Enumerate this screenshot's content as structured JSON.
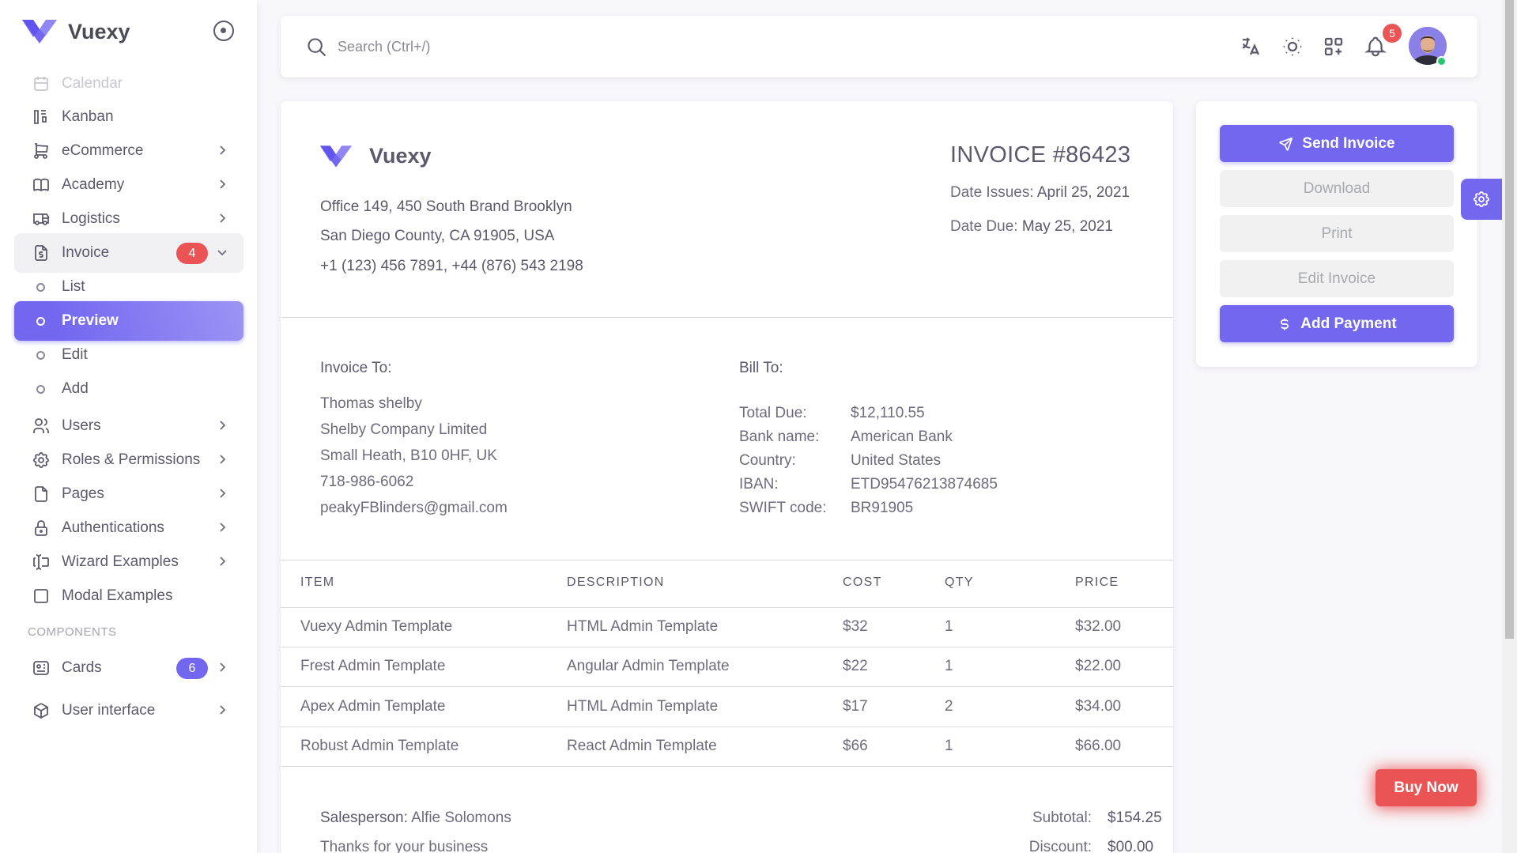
{
  "brand": {
    "name": "Vuexy"
  },
  "sidebar": {
    "items": [
      {
        "key": "calendar",
        "label": "Calendar",
        "icon": "calendar-icon",
        "chevron": false
      },
      {
        "key": "kanban",
        "label": "Kanban",
        "icon": "kanban-icon",
        "chevron": false
      },
      {
        "key": "ecommerce",
        "label": "eCommerce",
        "icon": "shopping-cart-icon",
        "chevron": true
      },
      {
        "key": "academy",
        "label": "Academy",
        "icon": "book-icon",
        "chevron": true
      },
      {
        "key": "logistics",
        "label": "Logistics",
        "icon": "truck-icon",
        "chevron": true
      },
      {
        "key": "invoice",
        "label": "Invoice",
        "icon": "invoice-icon",
        "badge": "4",
        "chevron": true
      },
      {
        "key": "invoice-list",
        "label": "List"
      },
      {
        "key": "invoice-preview",
        "label": "Preview"
      },
      {
        "key": "invoice-edit",
        "label": "Edit"
      },
      {
        "key": "invoice-add",
        "label": "Add"
      },
      {
        "key": "users",
        "label": "Users",
        "icon": "users-icon",
        "chevron": true
      },
      {
        "key": "roles",
        "label": "Roles & Permissions",
        "icon": "settings-icon",
        "chevron": true
      },
      {
        "key": "pages",
        "label": "Pages",
        "icon": "file-icon",
        "chevron": true
      },
      {
        "key": "auth",
        "label": "Authentications",
        "icon": "lock-icon",
        "chevron": true
      },
      {
        "key": "wizard",
        "label": "Wizard Examples",
        "icon": "forms-icon",
        "chevron": true
      },
      {
        "key": "modal",
        "label": "Modal Examples",
        "icon": "square-icon",
        "chevron": false
      },
      {
        "key": "cards",
        "label": "Cards",
        "icon": "id-card-icon",
        "badge": "6",
        "chevron": true
      },
      {
        "key": "ui",
        "label": "User interface",
        "icon": "box-icon",
        "chevron": true
      }
    ],
    "components_header": "COMPONENTS"
  },
  "navbar": {
    "search_placeholder": "Search (Ctrl+/)",
    "notification_count": "5"
  },
  "invoice": {
    "brand": "Vuexy",
    "address": [
      "Office 149, 450 South Brand Brooklyn",
      "San Diego County, CA 91905, USA",
      "+1 (123) 456 7891, +44 (876) 543 2198"
    ],
    "number": "INVOICE #86423",
    "date_issued_label": "Date Issues:",
    "date_issued": "April 25, 2021",
    "date_due_label": "Date Due:",
    "date_due": "May 25, 2021",
    "invoice_to_label": "Invoice To:",
    "client": [
      "Thomas shelby",
      "Shelby Company Limited",
      "Small Heath, B10 0HF, UK",
      "718-986-6062",
      "peakyFBlinders@gmail.com"
    ],
    "bill_to_label": "Bill To:",
    "bill": [
      {
        "key": "Total Due:",
        "value": "$12,110.55"
      },
      {
        "key": "Bank name:",
        "value": "American Bank"
      },
      {
        "key": "Country:",
        "value": "United States"
      },
      {
        "key": "IBAN:",
        "value": "ETD95476213874685"
      },
      {
        "key": "SWIFT code:",
        "value": "BR91905"
      }
    ],
    "table": {
      "headers": [
        "ITEM",
        "DESCRIPTION",
        "COST",
        "QTY",
        "PRICE"
      ],
      "rows": [
        [
          "Vuexy Admin Template",
          "HTML Admin Template",
          "$32",
          "1",
          "$32.00"
        ],
        [
          "Frest Admin Template",
          "Angular Admin Template",
          "$22",
          "1",
          "$22.00"
        ],
        [
          "Apex Admin Template",
          "HTML Admin Template",
          "$17",
          "2",
          "$34.00"
        ],
        [
          "Robust Admin Template",
          "React Admin Template",
          "$66",
          "1",
          "$66.00"
        ]
      ]
    },
    "salesperson_label": "Salesperson:",
    "salesperson": "Alfie Solomons",
    "thanks": "Thanks for your business",
    "subtotal_label": "Subtotal:",
    "subtotal": "$154.25",
    "discount_label": "Discount:",
    "discount": "$00.00"
  },
  "actions": {
    "send": "Send Invoice",
    "download": "Download",
    "print": "Print",
    "edit": "Edit Invoice",
    "add_payment": "Add Payment"
  },
  "buy_now": "Buy Now",
  "colors": {
    "primary": "#7367f0",
    "danger": "#ea5455",
    "success": "#28c76f"
  }
}
